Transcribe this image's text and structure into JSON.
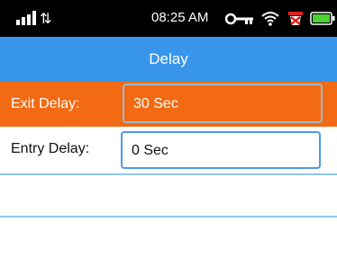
{
  "status_bar": {
    "time": "08:25 AM",
    "icons": [
      "signal-icon",
      "data-transfer-icon",
      "key-icon",
      "wifi-icon",
      "alarm-icon",
      "battery-icon"
    ]
  },
  "header": {
    "title": "Delay"
  },
  "rows": [
    {
      "label": "Exit Delay:",
      "value": "30 Sec",
      "selected": true
    },
    {
      "label": "Entry Delay:",
      "value": "0 Sec",
      "selected": false
    }
  ],
  "colors": {
    "header_bg": "#3796ea",
    "selected_row_bg": "#f26a13",
    "divider": "#8ec5f1",
    "status_bar_bg": "#000000"
  }
}
